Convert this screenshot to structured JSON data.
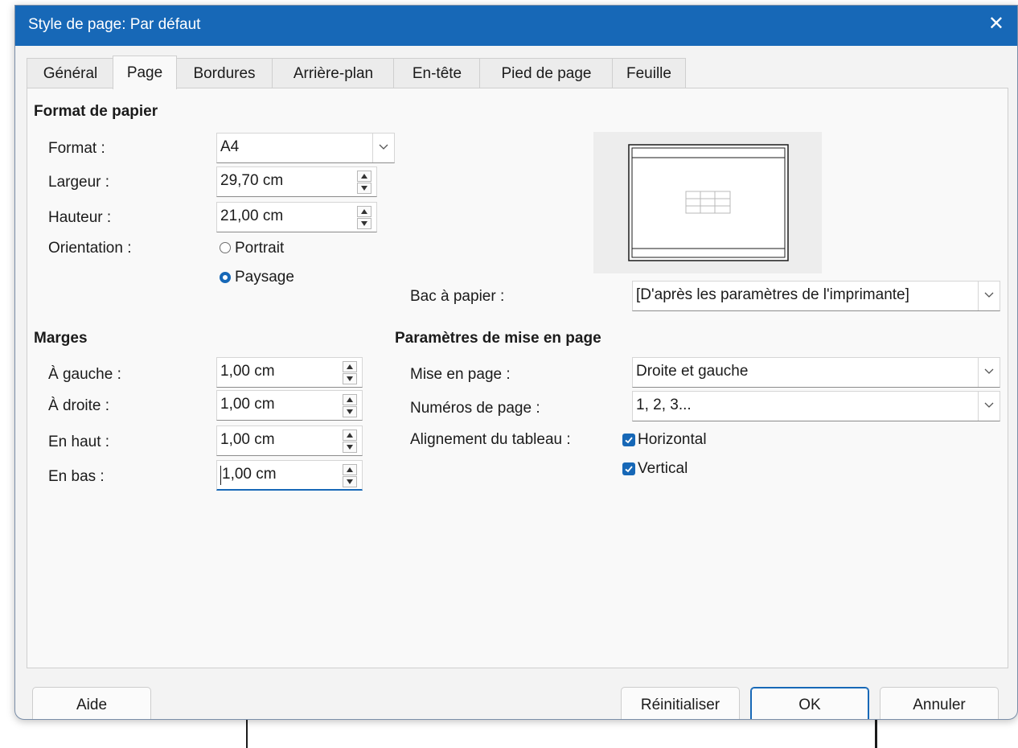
{
  "window": {
    "title": "Style de page: Par défaut",
    "close_glyph": "✕"
  },
  "tabs": [
    {
      "label": "Général"
    },
    {
      "label": "Page"
    },
    {
      "label": "Bordures"
    },
    {
      "label": "Arrière-plan"
    },
    {
      "label": "En-tête"
    },
    {
      "label": "Pied de page"
    },
    {
      "label": "Feuille"
    }
  ],
  "active_tab": "Page",
  "paper_format": {
    "heading": "Format de papier",
    "format_label": "Format :",
    "format_value": "A4",
    "width_label": "Largeur :",
    "width_value": "29,70 cm",
    "height_label": "Hauteur :",
    "height_value": "21,00 cm",
    "orientation_label": "Orientation :",
    "portrait_label": "Portrait",
    "landscape_label": "Paysage",
    "orientation_selected": "Paysage"
  },
  "paper_tray": {
    "label": "Bac à papier :",
    "value": "[D'après les paramètres de l'imprimante]"
  },
  "margins": {
    "heading": "Marges",
    "left_label": "À gauche :",
    "left_value": "1,00 cm",
    "right_label": "À droite :",
    "right_value": "1,00 cm",
    "top_label": "En haut :",
    "top_value": "1,00 cm",
    "bottom_label": "En bas :",
    "bottom_value": "1,00 cm"
  },
  "layout_settings": {
    "heading": "Paramètres de mise en page",
    "layout_label": "Mise en page :",
    "layout_value": "Droite et gauche",
    "numbering_label": "Numéros de page :",
    "numbering_value": "1, 2, 3...",
    "table_alignment_label": "Alignement du tableau :",
    "horizontal_label": "Horizontal",
    "horizontal_checked": true,
    "vertical_label": "Vertical",
    "vertical_checked": true
  },
  "buttons": {
    "help": "Aide",
    "reset": "Réinitialiser",
    "ok": "OK",
    "cancel": "Annuler"
  },
  "colors": {
    "titlebar": "#1768b7",
    "accent": "#1768b7",
    "dialog_bg": "#f3f3f3"
  }
}
